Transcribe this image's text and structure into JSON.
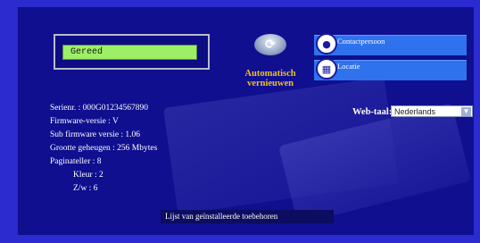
{
  "status": {
    "text": "Gereed"
  },
  "refresh": {
    "line1": "Automatisch",
    "line2": "vernieuwen",
    "icon": "refresh-icon",
    "color": "#f0c020"
  },
  "links": {
    "contact_label": "Contactpersoon",
    "contact_icon": "person-icon",
    "location_label": "Locatie",
    "location_icon": "building-icon"
  },
  "language": {
    "label": "Web-taal:",
    "selected": "Nederlands"
  },
  "info": {
    "serial": "Serienr. : 000G01234567890",
    "firmware": "Firmware-versie : V",
    "sub_firmware": "Sub firmware versie : 1.06",
    "memory": "Grootte geheugen : 256 Mbytes",
    "page_counter": "Paginateller : 8",
    "color_count": "Kleur : 2",
    "bw_count": "Z/w : 6"
  },
  "accessories": {
    "label": "Lijst van geïnstalleerde toebehoren"
  },
  "colors": {
    "background": "#2b2bd0",
    "panel": "#0f0f90",
    "status_green": "#9df066",
    "link_blue": "#2f72ee"
  }
}
